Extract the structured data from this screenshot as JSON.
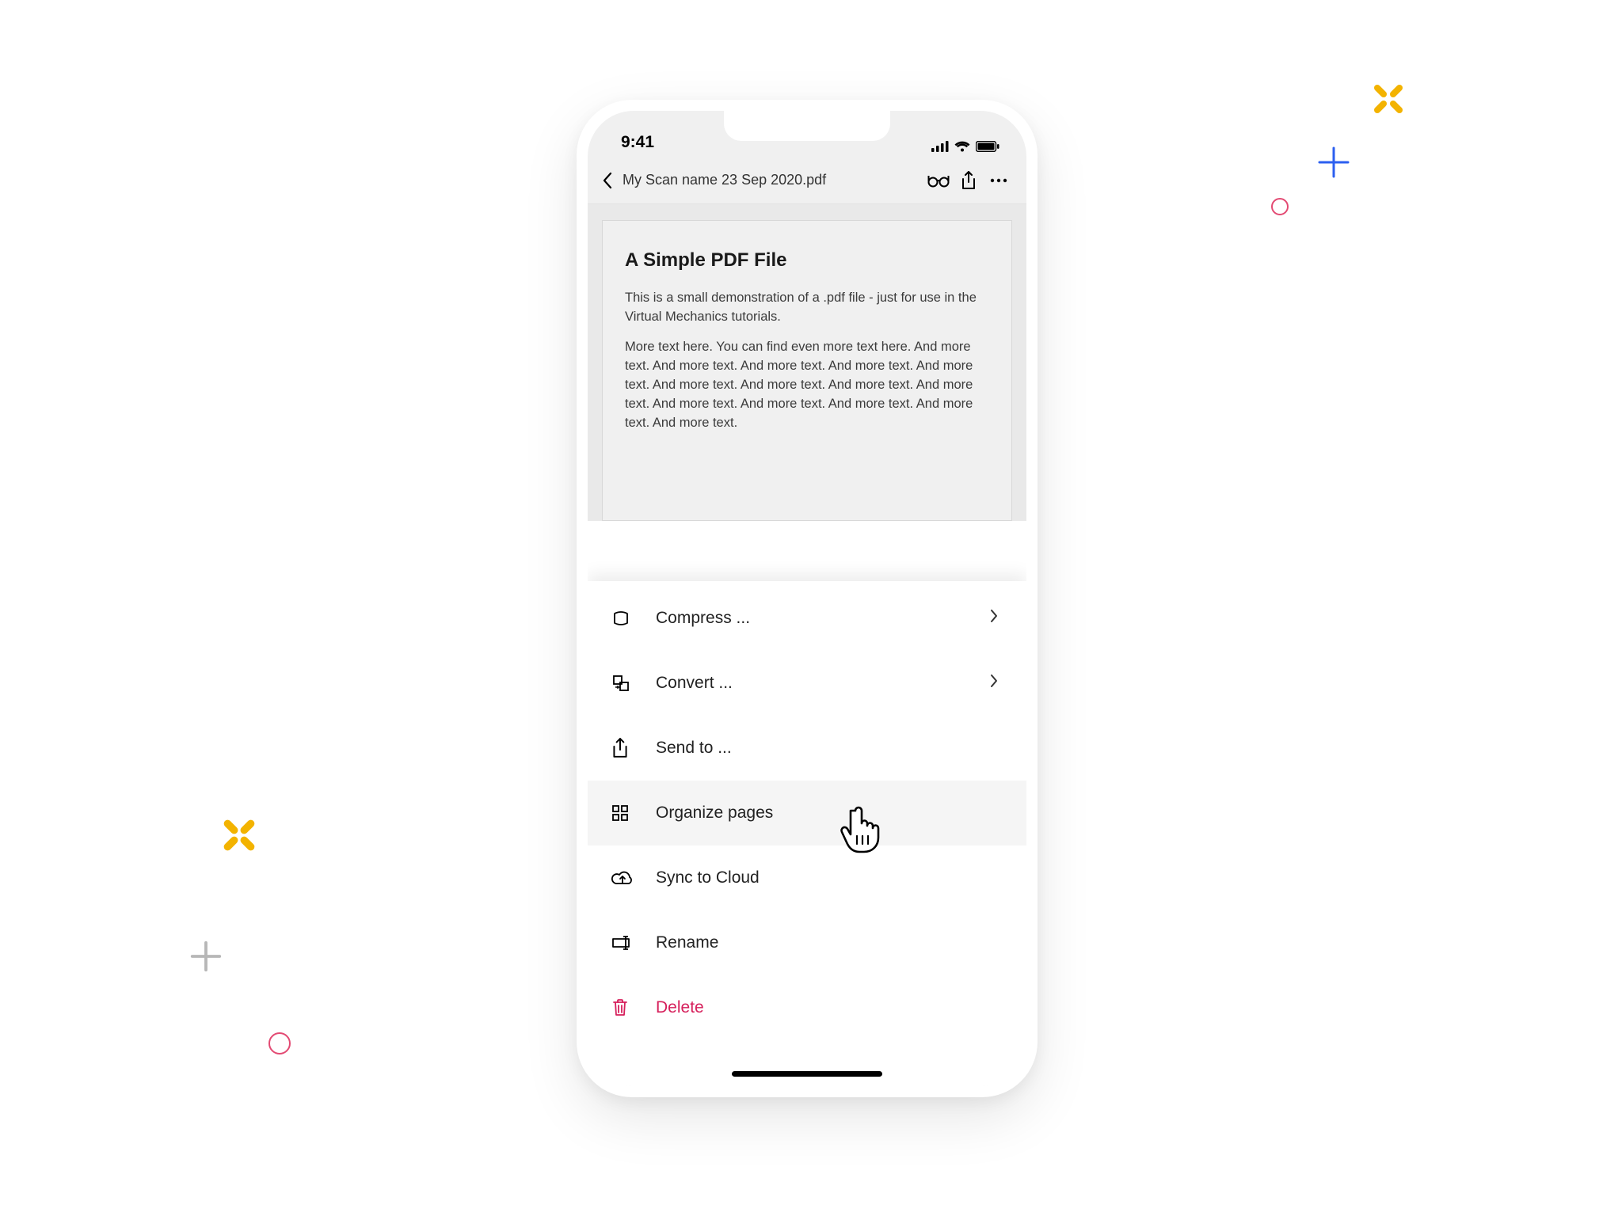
{
  "status": {
    "time": "9:41"
  },
  "topbar": {
    "filename": "My Scan name 23 Sep 2020.pdf"
  },
  "document": {
    "title": "A Simple PDF File",
    "p1": "This is a small demonstration of a .pdf file - just for use in the Virtual Mechanics tutorials.",
    "p2": "More text here. You can find even more text here. And more text. And more text. And more text. And more text. And more text. And more text. And more text. And more text. And more text. And more text. And more text. And more text. And more text. And more text."
  },
  "menu": {
    "compress": "Compress ...",
    "convert": "Convert ...",
    "sendto": "Send to ...",
    "organize": "Organize pages",
    "sync": "Sync to Cloud",
    "rename": "Rename",
    "delete": "Delete"
  }
}
